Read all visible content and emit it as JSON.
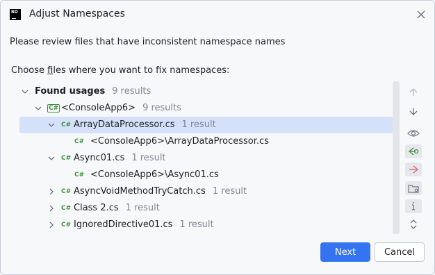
{
  "window": {
    "title": "Adjust Namespaces",
    "logo_text": "RD"
  },
  "description": "Please review files that have inconsistent namespace names",
  "choose_label": {
    "before": "Choose ",
    "mnemonic": "f",
    "after": "iles where you want to fix namespaces:"
  },
  "tree": {
    "root": {
      "label": "Found usages",
      "count": "9 results"
    },
    "project": {
      "label": "<ConsoleApp6>",
      "count": "9 results",
      "icon": "csharp-project-icon"
    },
    "files": [
      {
        "label": "ArrayDataProcessor.cs",
        "count": "1 result",
        "expanded": true,
        "child": "<ConsoleApp6>\\ArrayDataProcessor.cs"
      },
      {
        "label": "Async01.cs",
        "count": "1 result",
        "expanded": true,
        "child": "<ConsoleApp6>\\Async01.cs"
      },
      {
        "label": "AsyncVoidMethodTryCatch.cs",
        "count": "1 result",
        "expanded": false
      },
      {
        "label": "Class 2.cs",
        "count": "1 result",
        "expanded": false
      },
      {
        "label": "IgnoredDirective01.cs",
        "count": "1 result",
        "expanded": false
      }
    ],
    "cs_badge": "C#"
  },
  "toolbar": [
    "arrow-up-icon",
    "arrow-down-icon",
    "eye-icon",
    "include-icon",
    "exclude-icon",
    "folder-settings-icon",
    "info-icon",
    "expand-collapse-icon"
  ],
  "buttons": {
    "next": "Next",
    "cancel": "Cancel"
  },
  "colors": {
    "accent": "#3574f0",
    "selection": "#d5e1f9",
    "csharp": "#3f8f3f",
    "muted": "#818594"
  }
}
